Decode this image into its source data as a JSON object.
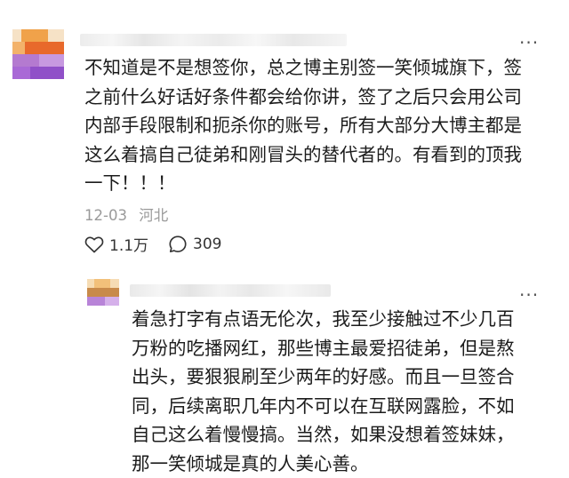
{
  "main_comment": {
    "username": "",
    "text": "不知道是不是想签你，总之博主别签一笑倾城旗下，签\n之前什么好话好条件都会给你讲，签了之后只会用公司\n内部手段限制和扼杀你的账号，所有大部分大博主都是\n这么着搞自己徒弟和刚冒头的替代者的。有看到的顶我\n一下！！！",
    "date": "12-03",
    "location": "河北",
    "likes": "1.1万",
    "comments": "309",
    "more_label": "···"
  },
  "reply_comment": {
    "username": "",
    "text": "着急打字有点语无伦次，我至少接触过不少几百\n万粉的吃播网红，那些博主最爱招徒弟，但是熬\n出头，要狠狠刷至少两年的好感。而且一旦签合\n同，后续离职几年内不可以在互联网露脸，不如\n自己这么着慢慢搞。当然，如果没想着签妹妹，\n那一笑倾城是真的人美心善。",
    "more_label": "···"
  },
  "icons": {
    "like": "heart-icon",
    "comment": "comment-bubble-icon",
    "more": "more-dots-icon"
  },
  "colors": {
    "meta_gray": "#9a9a9a",
    "avatar1": [
      "#f0a24a",
      "#e8692b",
      "#b47ad0",
      "#9050c8"
    ],
    "avatar2": [
      "#f2c07a",
      "#c88a4a",
      "#b884d8"
    ]
  }
}
